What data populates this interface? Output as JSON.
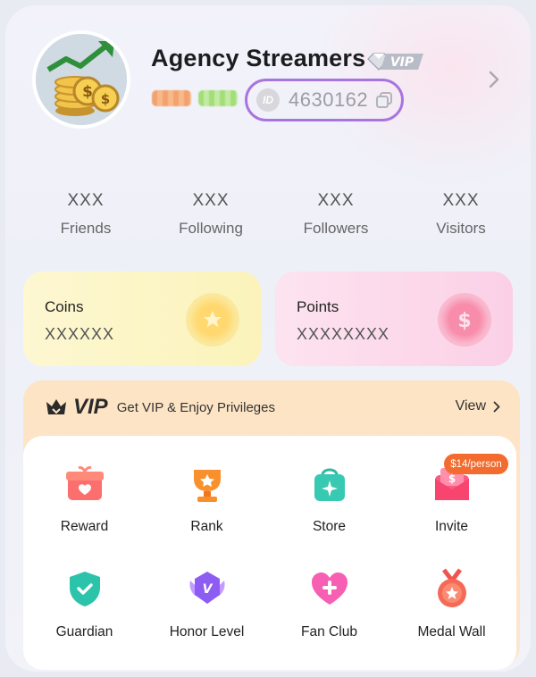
{
  "profile": {
    "name": "Agency Streamers",
    "vip_label": "VIP",
    "id_prefix": "ID",
    "id_value": "4630162"
  },
  "stats": [
    {
      "value": "XXX",
      "label": "Friends"
    },
    {
      "value": "XXX",
      "label": "Following"
    },
    {
      "value": "XXX",
      "label": "Followers"
    },
    {
      "value": "XXX",
      "label": "Visitors"
    }
  ],
  "wallet": {
    "coins": {
      "title": "Coins",
      "value": "XXXXXX"
    },
    "points": {
      "title": "Points",
      "value": "XXXXXXXX"
    }
  },
  "vip": {
    "brand": "VIP",
    "tagline": "Get VIP & Enjoy Privileges",
    "view_label": "View"
  },
  "features": [
    {
      "label": "Reward",
      "icon": "gift-icon"
    },
    {
      "label": "Rank",
      "icon": "trophy-icon"
    },
    {
      "label": "Store",
      "icon": "shopping-bag-icon"
    },
    {
      "label": "Invite",
      "icon": "invite-envelope-icon",
      "promo": "$14/person"
    },
    {
      "label": "Guardian",
      "icon": "shield-icon"
    },
    {
      "label": "Honor Level",
      "icon": "honor-badge-icon"
    },
    {
      "label": "Fan Club",
      "icon": "heart-icon"
    },
    {
      "label": "Medal Wall",
      "icon": "medal-icon"
    }
  ],
  "colors": {
    "id_outline": "#a874e0",
    "promo": "#f36b2e",
    "vip_panel": "#fde4c4"
  }
}
